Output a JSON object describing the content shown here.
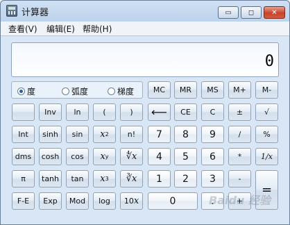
{
  "window": {
    "title": "计算器"
  },
  "titlebar": {
    "minimize_glyph": "▭",
    "maximize_glyph": "◻",
    "close_glyph": "✕"
  },
  "menu": {
    "items": [
      "查看(V)",
      "编辑(E)",
      "帮助(H)"
    ]
  },
  "display": {
    "value": "0"
  },
  "angle_units": {
    "options": [
      "度",
      "弧度",
      "梯度"
    ],
    "selected": "度"
  },
  "memory": [
    "MC",
    "MR",
    "MS",
    "M+",
    "M-"
  ],
  "row1": {
    "inv": "Inv",
    "ln": "ln",
    "lparen": "(",
    "rparen": ")",
    "backspace": "⟵",
    "ce": "CE",
    "c": "C",
    "plusminus": "±",
    "sqrt": "√"
  },
  "row2": {
    "int": "Int",
    "sinh": "sinh",
    "sin": "sin",
    "x2": "x",
    "x2_sup": "2",
    "fact": "n!",
    "n7": "7",
    "n8": "8",
    "n9": "9",
    "div": "/",
    "pct": "%"
  },
  "row3": {
    "dms": "dms",
    "cosh": "cosh",
    "cos": "cos",
    "xy": "x",
    "xy_sup": "y",
    "yroot": "∜x",
    "n4": "4",
    "n5": "5",
    "n6": "6",
    "mul": "*",
    "recip": "1/x"
  },
  "row4": {
    "pi": "π",
    "tanh": "tanh",
    "tan": "tan",
    "x3": "x",
    "x3_sup": "3",
    "cbrt": "∛x",
    "n1": "1",
    "n2": "2",
    "n3": "3",
    "sub": "-",
    "eq": "="
  },
  "row5": {
    "fe": "F-E",
    "exp": "Exp",
    "mod": "Mod",
    "log": "log",
    "tenx": "10",
    "tenx_sup": "x",
    "n0": "0",
    "dot": ".",
    "add": "+"
  },
  "watermark": "Baidu 经验"
}
